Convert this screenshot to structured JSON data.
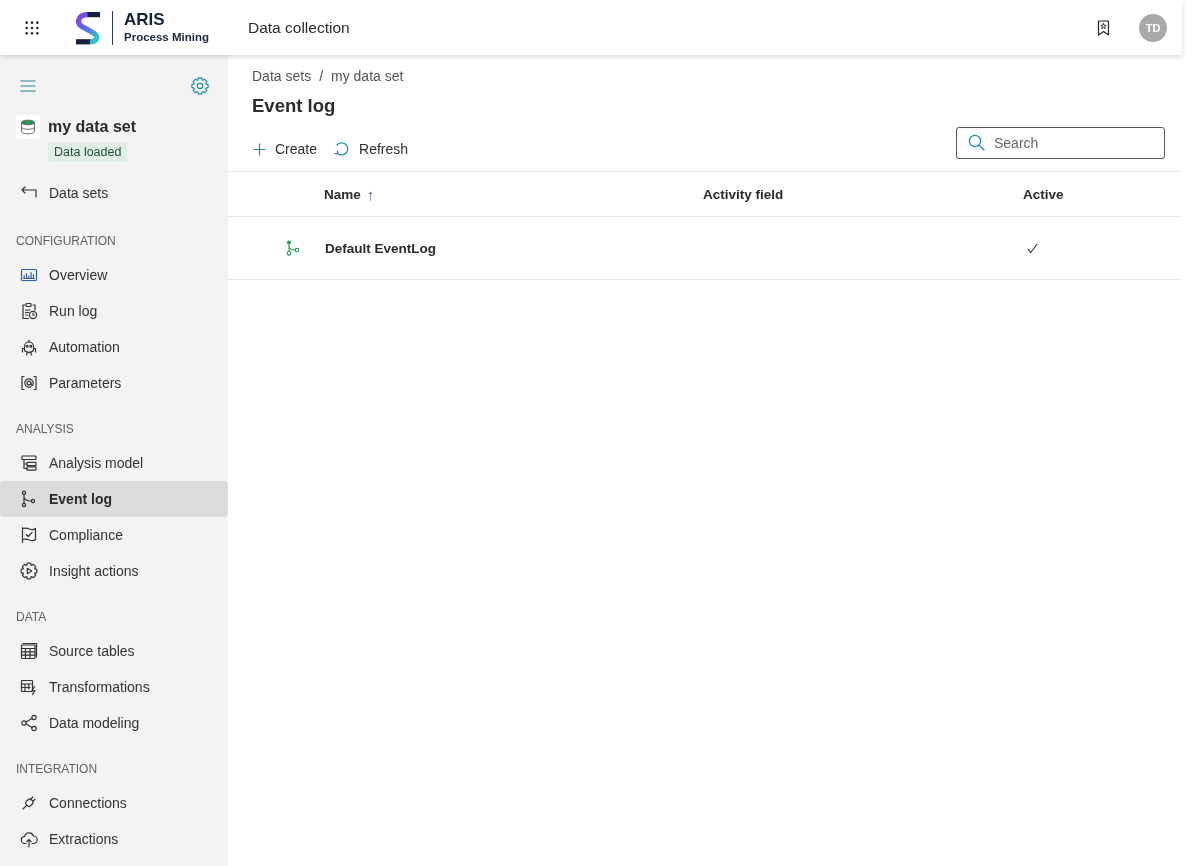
{
  "header": {
    "brand": {
      "name": "ARIS",
      "subtitle": "Process Mining"
    },
    "title": "Data collection",
    "user": {
      "initials": "TD"
    }
  },
  "sidebar": {
    "dataset": {
      "name": "my data set",
      "status": "Data loaded"
    },
    "back_link": {
      "label": "Data sets"
    },
    "sections": [
      {
        "title": "CONFIGURATION",
        "items": [
          {
            "label": "Overview",
            "selected": false
          },
          {
            "label": "Run log",
            "selected": false
          },
          {
            "label": "Automation",
            "selected": false
          },
          {
            "label": "Parameters",
            "selected": false
          }
        ]
      },
      {
        "title": "ANALYSIS",
        "items": [
          {
            "label": "Analysis model",
            "selected": false
          },
          {
            "label": "Event log",
            "selected": true
          },
          {
            "label": "Compliance",
            "selected": false
          },
          {
            "label": "Insight actions",
            "selected": false
          }
        ]
      },
      {
        "title": "DATA",
        "items": [
          {
            "label": "Source tables",
            "selected": false
          },
          {
            "label": "Transformations",
            "selected": false
          },
          {
            "label": "Data modeling",
            "selected": false
          }
        ]
      },
      {
        "title": "INTEGRATION",
        "items": [
          {
            "label": "Connections",
            "selected": false
          },
          {
            "label": "Extractions",
            "selected": false
          }
        ]
      }
    ]
  },
  "breadcrumb": {
    "items": [
      "Data sets",
      "my data set"
    ],
    "separator": "/"
  },
  "page": {
    "title": "Event log"
  },
  "toolbar": {
    "buttons": [
      {
        "label": "Create"
      },
      {
        "label": "Refresh"
      }
    ],
    "search": {
      "placeholder": "Search"
    }
  },
  "table": {
    "columns": [
      {
        "label": "Name",
        "sort_arrow": "↑"
      },
      {
        "label": "Activity field"
      },
      {
        "label": "Active"
      }
    ],
    "rows": [
      {
        "name": "Default EventLog",
        "active": true
      }
    ]
  }
}
